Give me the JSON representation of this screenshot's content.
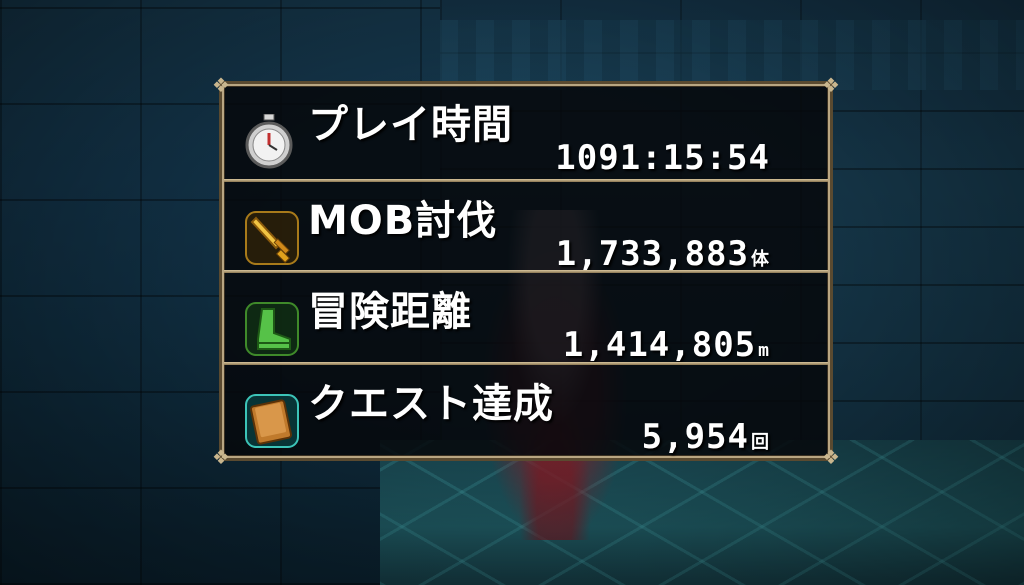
{
  "stats": [
    {
      "label": "プレイ時間",
      "value": "1091:15:54",
      "unit": "",
      "icon": "stopwatch-icon"
    },
    {
      "label": "MOB討伐",
      "value": "1,733,883",
      "unit": "体",
      "icon": "sword-icon"
    },
    {
      "label": "冒険距離",
      "value": "1,414,805",
      "unit": "m",
      "icon": "boot-icon"
    },
    {
      "label": "クエスト達成",
      "value": "5,954",
      "unit": "回",
      "icon": "book-icon"
    }
  ],
  "colors": {
    "panel_border": "#b9a682",
    "text": "#ffffff",
    "sword": "#e0a11c",
    "boot": "#3fae3a",
    "book": "#c07a2c"
  }
}
